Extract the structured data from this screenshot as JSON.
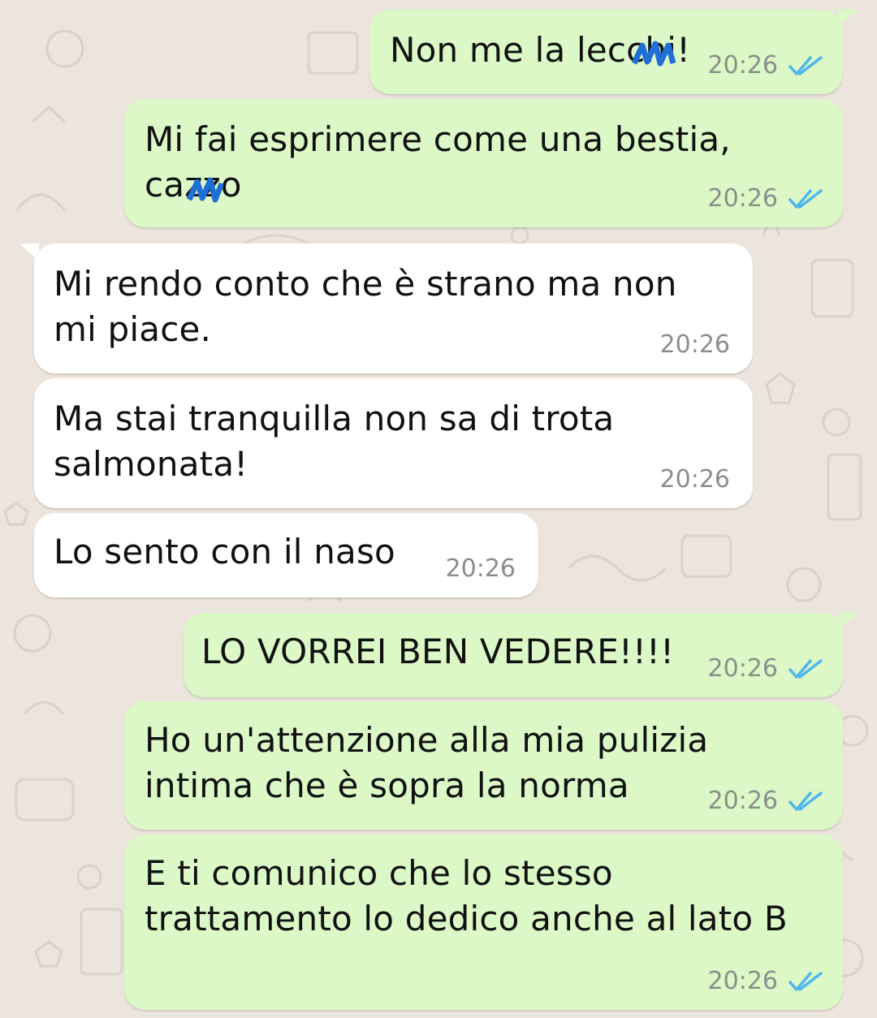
{
  "conversation": {
    "messages": [
      {
        "dir": "out",
        "text": "Non me la lecchi!",
        "time": "20:26",
        "status": "read"
      },
      {
        "dir": "out",
        "text": "Mi fai esprimere come una bestia,\ncazzo",
        "time": "20:26",
        "status": "read"
      },
      {
        "dir": "in",
        "text": "Mi rendo conto che è strano ma non\nmi piace.",
        "time": "20:26"
      },
      {
        "dir": "in",
        "text": "Ma stai tranquilla non sa di trota\nsalmonata!",
        "time": "20:26"
      },
      {
        "dir": "in",
        "text": "Lo sento con il naso",
        "time": "20:26"
      },
      {
        "dir": "out",
        "text": "LO VORREI BEN VEDERE!!!!",
        "time": "20:26",
        "status": "read"
      },
      {
        "dir": "out",
        "text": "Ho un'attenzione alla mia pulizia\nintima che è sopra la norma",
        "time": "20:26",
        "status": "read"
      },
      {
        "dir": "out",
        "text": "E ti comunico che lo stesso\ntrattamento lo dedico anche al lato B",
        "time": "20:26",
        "status": "read"
      }
    ]
  },
  "colors": {
    "outgoing": "#dcf8c6",
    "incoming": "#ffffff",
    "background": "#ece5dd",
    "read_ticks": "#4fb6ec",
    "timestamp": "#8a8f8a"
  },
  "icons": {
    "read_receipt": "double-check-icon",
    "censor": "scribble-censor-mark"
  }
}
